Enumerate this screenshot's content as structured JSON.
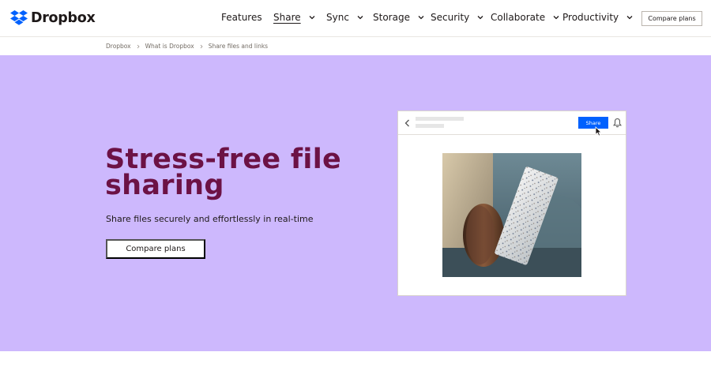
{
  "brand": {
    "name": "Dropbox",
    "color": "#0061fe"
  },
  "nav": {
    "items": [
      {
        "label": "Features",
        "dropdown": false
      },
      {
        "label": "Share",
        "dropdown": true,
        "active": true
      },
      {
        "label": "Sync",
        "dropdown": true
      },
      {
        "label": "Storage",
        "dropdown": true
      },
      {
        "label": "Security",
        "dropdown": true
      },
      {
        "label": "Collaborate",
        "dropdown": true
      },
      {
        "label": "Productivity",
        "dropdown": true
      }
    ],
    "cta_label": "Compare plans"
  },
  "breadcrumb": [
    "Dropbox",
    "What is Dropbox",
    "Share files and links"
  ],
  "hero": {
    "title": "Stress-free file sharing",
    "subtitle": "Share files securely and effortlessly in real-time",
    "button_label": "Compare plans",
    "background": "#cdb8fd",
    "title_color": "#6c1245"
  },
  "mockup": {
    "share_label": "Share",
    "share_color": "#0061fe"
  }
}
